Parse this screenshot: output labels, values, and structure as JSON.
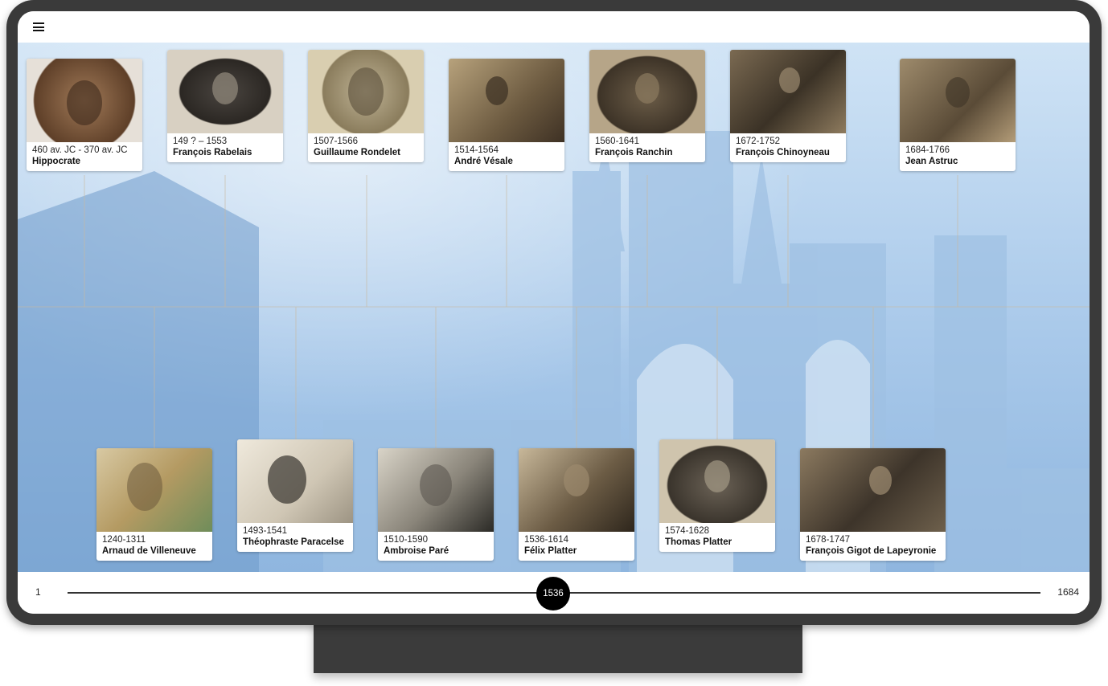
{
  "header": {
    "menu_icon": "hamburger-menu-icon"
  },
  "top_row": [
    {
      "dates": "460 av. JC - 370 av. JC",
      "name": "Hippocrate"
    },
    {
      "dates": "149 ? – 1553",
      "name": "François Rabelais"
    },
    {
      "dates": "1507-1566",
      "name": "Guillaume Rondelet"
    },
    {
      "dates": "1514-1564",
      "name": "André Vésale"
    },
    {
      "dates": "1560-1641",
      "name": "François Ranchin"
    },
    {
      "dates": "1672-1752",
      "name": "François Chinoyneau"
    },
    {
      "dates": "1684-1766",
      "name": "Jean Astruc"
    }
  ],
  "bottom_row": [
    {
      "dates": "1240-1311",
      "name": "Arnaud de Villeneuve"
    },
    {
      "dates": "1493-1541",
      "name": "Théophraste Paracelse"
    },
    {
      "dates": "1510-1590",
      "name": "Ambroise Paré"
    },
    {
      "dates": "1536-1614",
      "name": "Félix Platter"
    },
    {
      "dates": "1574-1628",
      "name": "Thomas Platter"
    },
    {
      "dates": "1678-1747",
      "name": "François Gigot de Lapeyronie"
    }
  ],
  "timeline": {
    "start": "1",
    "end": "1684",
    "current": "1536"
  },
  "colors": {
    "background_tint": "#a9c9ea",
    "thumb": "#000000",
    "bezel": "#3a3a3a"
  }
}
